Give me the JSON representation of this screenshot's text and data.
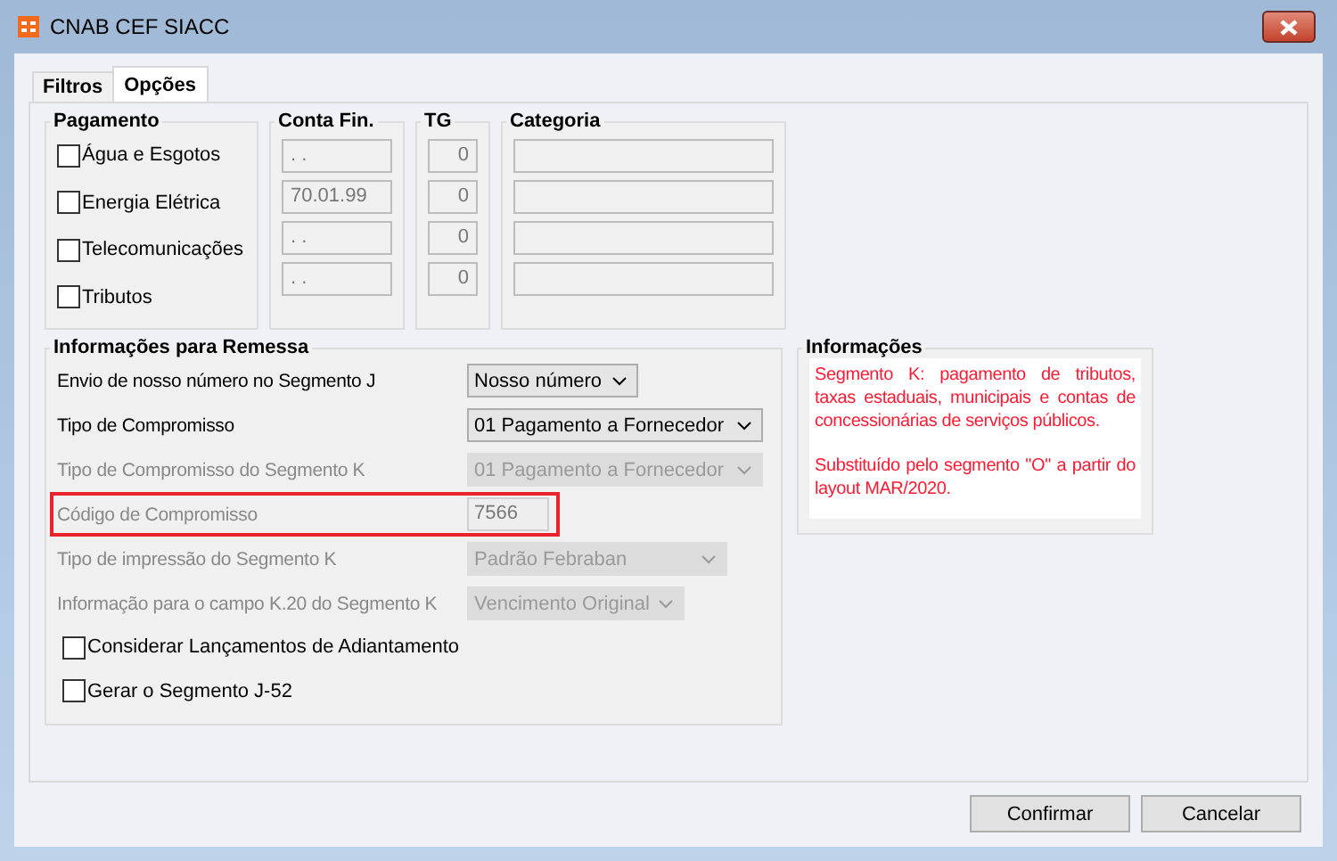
{
  "window": {
    "title": "CNAB CEF SIACC"
  },
  "tabs": [
    {
      "label": "Filtros",
      "selected": false
    },
    {
      "label": "Opções",
      "selected": true
    }
  ],
  "payment": {
    "headers": [
      "Pagamento",
      "Conta Fin.",
      "TG",
      "Categoria"
    ],
    "rows": [
      {
        "label": "Água e Esgotos",
        "checked": false,
        "account": ". .",
        "tg": "0"
      },
      {
        "label": "Energia Elétrica",
        "checked": false,
        "account": "70.01.99",
        "tg": "0"
      },
      {
        "label": "Telecomunicações",
        "checked": false,
        "account": ". .",
        "tg": "0"
      },
      {
        "label": "Tributos",
        "checked": false,
        "account": ". .",
        "tg": "0"
      }
    ]
  },
  "remessa": {
    "title": "Informações para Remessa",
    "rows": [
      {
        "kind": "select",
        "label": "Envio de nosso número no Segmento J",
        "value": "Nosso número",
        "disabled": false,
        "highlighted": false
      },
      {
        "kind": "select",
        "label": "Tipo de Compromisso",
        "value": "01 Pagamento a Fornecedor",
        "disabled": false,
        "highlighted": false
      },
      {
        "kind": "select",
        "label": "Tipo de Compromisso do Segmento K",
        "value": "01 Pagamento a Fornecedor",
        "disabled": true,
        "highlighted": false
      },
      {
        "kind": "text",
        "label": "Código de Compromisso",
        "value": "7566",
        "disabled": true,
        "highlighted": true
      },
      {
        "kind": "select",
        "label": "Tipo de impressão do Segmento K",
        "value": "Padrão Febraban",
        "disabled": true,
        "highlighted": false
      },
      {
        "kind": "select",
        "label": "Informação para o campo K.20 do Segmento K",
        "value": "Vencimento Original",
        "disabled": true,
        "highlighted": false
      },
      {
        "kind": "check",
        "label": "Considerar Lançamentos de Adiantamento",
        "checked": false
      },
      {
        "kind": "check",
        "label": "Gerar o Segmento J-52",
        "checked": false
      }
    ]
  },
  "info": {
    "title": "Informações",
    "paragraphs": [
      "Segmento K: pagamento de tributos, taxas estaduais, municipais e contas de concessionárias de serviços públicos.",
      "Substituído pelo segmento \"O\" a partir do layout MAR/2020."
    ]
  },
  "buttons": [
    "Confirmar",
    "Cancelar"
  ]
}
